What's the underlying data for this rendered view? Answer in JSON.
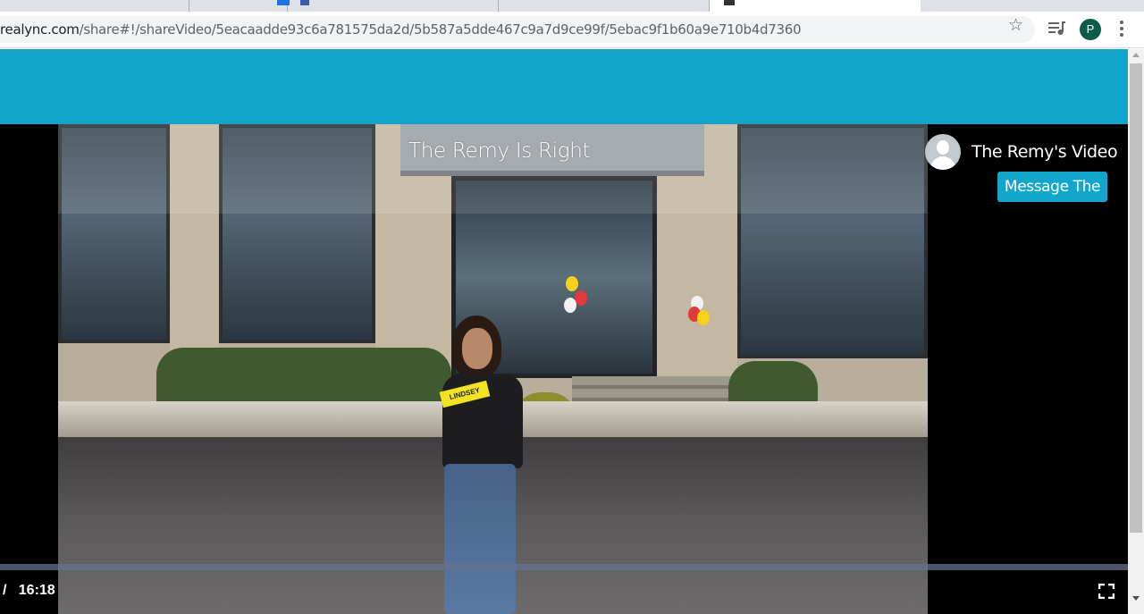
{
  "browser": {
    "url_host": "realync.com",
    "url_path": "/share#!/shareVideo/5eacaadde93c6a781575da2d/5b587a5dde467c9a7d9ce99f/5ebac9f1b60a9e710b4d7360",
    "profile_initial": "P",
    "icons": {
      "bookmark": "star-icon",
      "media": "media-playlist-icon",
      "menu": "more-vert-icon"
    }
  },
  "video": {
    "title": "The Remy Is Right",
    "name_tag_text": "LINDSEY",
    "time_display": "/   16:18",
    "fullscreen_icon": "fullscreen-icon"
  },
  "owner": {
    "name": "The Remy's Video",
    "message_button": "Message The"
  },
  "colors": {
    "brand": "#12a5cc",
    "profile": "#0d5c4a"
  }
}
